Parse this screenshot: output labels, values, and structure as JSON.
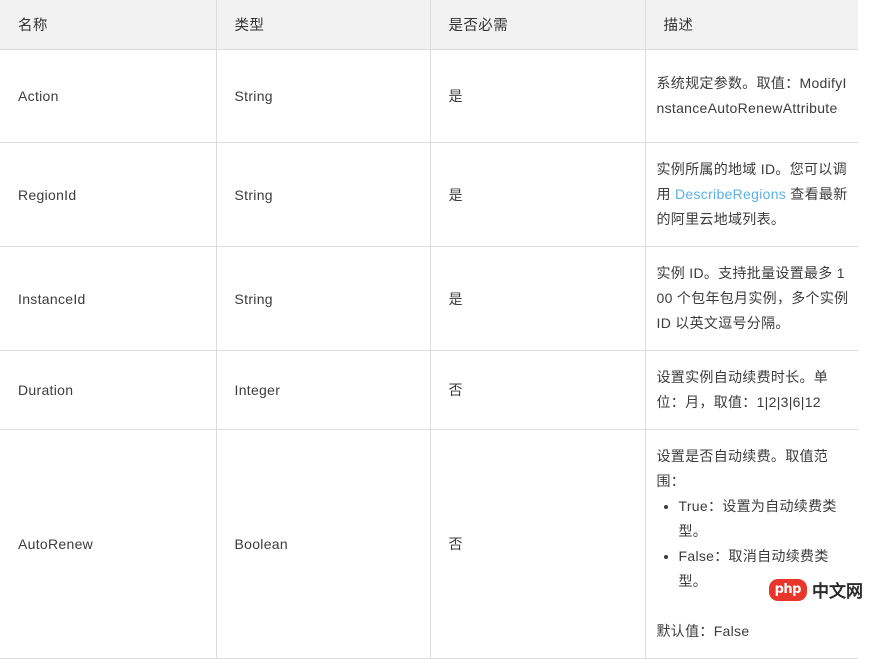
{
  "table": {
    "columns": [
      {
        "label": "名称",
        "key": "name"
      },
      {
        "label": "类型",
        "key": "type"
      },
      {
        "label": "是否必需",
        "key": "required"
      },
      {
        "label": "描述",
        "key": "description"
      }
    ],
    "rows": [
      {
        "name": "Action",
        "type": "String",
        "required": "是",
        "description": "系统规定参数。取值：ModifyInstanceAutoRenewAttribute"
      },
      {
        "name": "RegionId",
        "type": "String",
        "required": "是",
        "description_prefix": "实例所属的地域 ID。您可以调用 ",
        "description_link": "DescribeRegions",
        "description_suffix": " 查看最新的阿里云地域列表。"
      },
      {
        "name": "InstanceId",
        "type": "String",
        "required": "是",
        "description": "实例 ID。支持批量设置最多 100 个包年包月实例，多个实例 ID 以英文逗号分隔。"
      },
      {
        "name": "Duration",
        "type": "Integer",
        "required": "否",
        "description": "设置实例自动续费时长。单位：月，取值：1|2|3|6|12"
      },
      {
        "name": "AutoRenew",
        "type": "Boolean",
        "required": "否",
        "description_intro": "设置是否自动续费。取值范围：",
        "description_bullets": [
          "True：设置为自动续费类型。",
          "False：取消自动续费类型。"
        ],
        "description_default": "默认值：False"
      }
    ]
  },
  "watermark": {
    "badge": "php",
    "text": "中文网"
  },
  "colors": {
    "header_bg": "#f2f2f2",
    "border": "#dddddd",
    "text": "#3c3c3c",
    "link": "#5bb0e8",
    "watermark_badge_bg": "#e8372a"
  }
}
